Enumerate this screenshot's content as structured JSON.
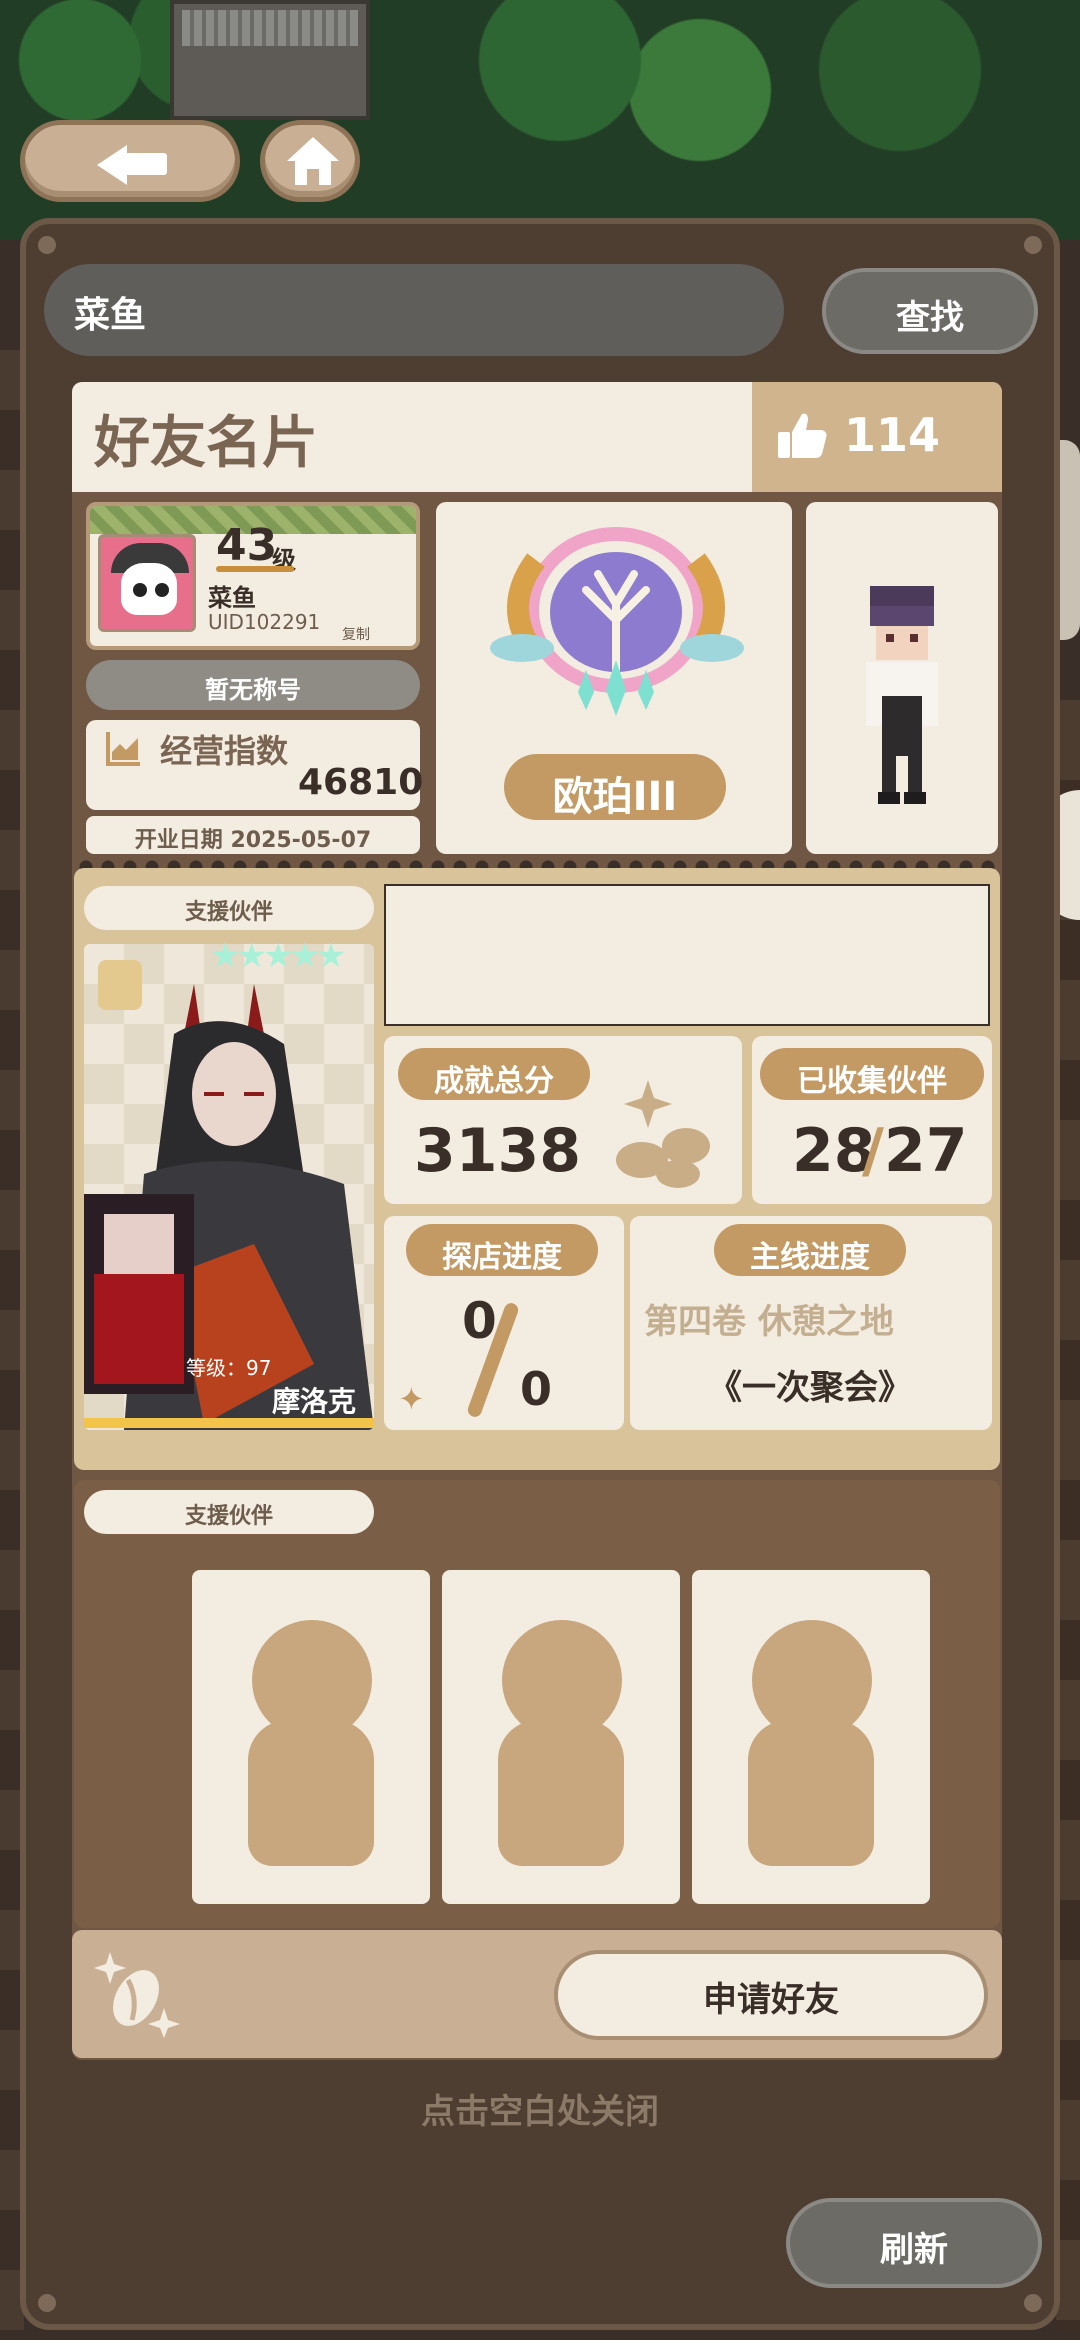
{
  "search": {
    "value": "菜鱼",
    "button_label": "查找"
  },
  "card": {
    "title": "好友名片",
    "likes": "114"
  },
  "profile": {
    "level": "43",
    "level_suffix": "级",
    "name": "菜鱼",
    "uid": "UID102291",
    "copy_label": "复制",
    "title_text": "暂无称号",
    "business_label": "经营指数",
    "business_value": "46810",
    "open_date": "开业日期 2025-05-07"
  },
  "badge": {
    "rank": "欧珀III"
  },
  "support": {
    "label": "支援伙伴",
    "partner_level": "等级：97",
    "partner_name": "摩洛克",
    "stars": "★★★★★"
  },
  "stats": {
    "achievement_label": "成就总分",
    "achievement_value": "3138",
    "collected_label": "已收集伙伴",
    "collected_value": "28",
    "collected_sep": "/",
    "collected_total": "27",
    "explore_label": "探店进度",
    "explore_done": "0",
    "explore_total": "0",
    "main_label": "主线进度",
    "main_chapter": "第四卷 休憩之地",
    "main_title": "《一次聚会》"
  },
  "lower": {
    "label": "支援伙伴"
  },
  "actions": {
    "apply_label": "申请好友",
    "close_hint": "点击空白处关闭",
    "refresh_label": "刷新"
  },
  "colors": {
    "panel": "#4e3e31",
    "card_light": "#f3ede1",
    "accent": "#c39a64",
    "text_dark": "#3a2f28"
  }
}
